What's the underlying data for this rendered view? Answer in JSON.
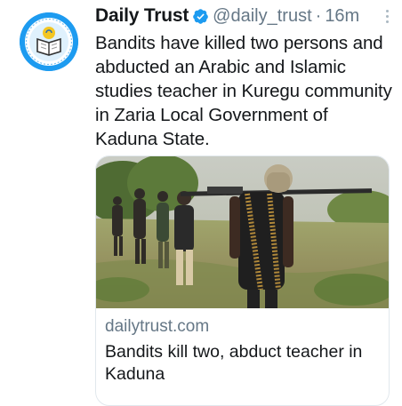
{
  "tweet": {
    "account_name": "Daily Trust",
    "handle": "@daily_trust",
    "separator": "·",
    "time": "16m",
    "text": "Bandits have killed two persons and abducted an Arabic and Islamic studies teacher in Kuregu community in Zaria Local Government of Kaduna State."
  },
  "card": {
    "domain": "dailytrust.com",
    "title": "Bandits kill two, abduct teacher in Kaduna"
  },
  "icons": {
    "avatar": "daily-trust-logo",
    "verified": "verified-badge-icon",
    "more": "more-options-icon"
  },
  "colors": {
    "accent": "#1d9bf0",
    "text": "#14171a",
    "muted": "#657786"
  }
}
